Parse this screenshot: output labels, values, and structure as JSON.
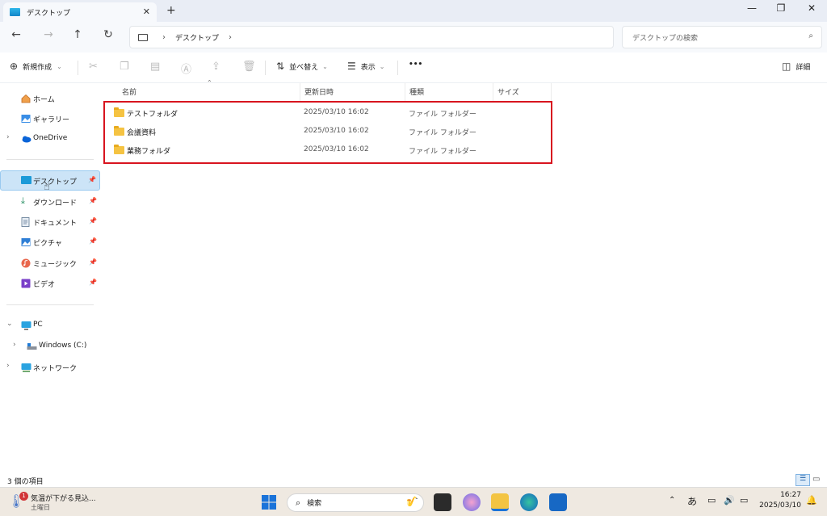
{
  "tab": {
    "title": "デスクトップ"
  },
  "address": {
    "crumb": "デスクトップ"
  },
  "search": {
    "placeholder": "デスクトップの検索"
  },
  "toolbar": {
    "new_label": "新規作成",
    "sort_label": "並べ替え",
    "view_label": "表示",
    "more_label": "•••",
    "details_label": "詳細"
  },
  "sidebar": {
    "items": [
      {
        "label": "ホーム",
        "icon": "home-icon"
      },
      {
        "label": "ギャラリー",
        "icon": "gallery-icon"
      },
      {
        "label": "OneDrive",
        "icon": "cloud-icon"
      },
      {
        "label": "デスクトップ",
        "icon": "desktop-icon"
      },
      {
        "label": "ダウンロード",
        "icon": "download-icon"
      },
      {
        "label": "ドキュメント",
        "icon": "document-icon"
      },
      {
        "label": "ピクチャ",
        "icon": "picture-icon"
      },
      {
        "label": "ミュージック",
        "icon": "music-icon"
      },
      {
        "label": "ビデオ",
        "icon": "video-icon"
      },
      {
        "label": "PC",
        "icon": "pc-icon"
      },
      {
        "label": "Windows (C:)",
        "icon": "drive-icon"
      },
      {
        "label": "ネットワーク",
        "icon": "network-icon"
      }
    ]
  },
  "columns": {
    "name": "名前",
    "date": "更新日時",
    "type": "種類",
    "size": "サイズ"
  },
  "files": [
    {
      "name": "テストフォルダ",
      "date": "2025/03/10 16:02",
      "type": "ファイル フォルダー"
    },
    {
      "name": "会議資料",
      "date": "2025/03/10 16:02",
      "type": "ファイル フォルダー"
    },
    {
      "name": "業務フォルダ",
      "date": "2025/03/10 16:02",
      "type": "ファイル フォルダー"
    }
  ],
  "status": {
    "count": "3 個の項目"
  },
  "taskbar": {
    "weather_title": "気温が下がる見込...",
    "weather_sub": "土曜日",
    "weather_badge": "1",
    "search_label": "検索",
    "ime": "あ",
    "time": "16:27",
    "date": "2025/03/10"
  },
  "colors": {
    "accent": "#0067c0",
    "highlight_box": "#d8141f",
    "folder": "#f5c342",
    "selected": "#cce4f7"
  }
}
